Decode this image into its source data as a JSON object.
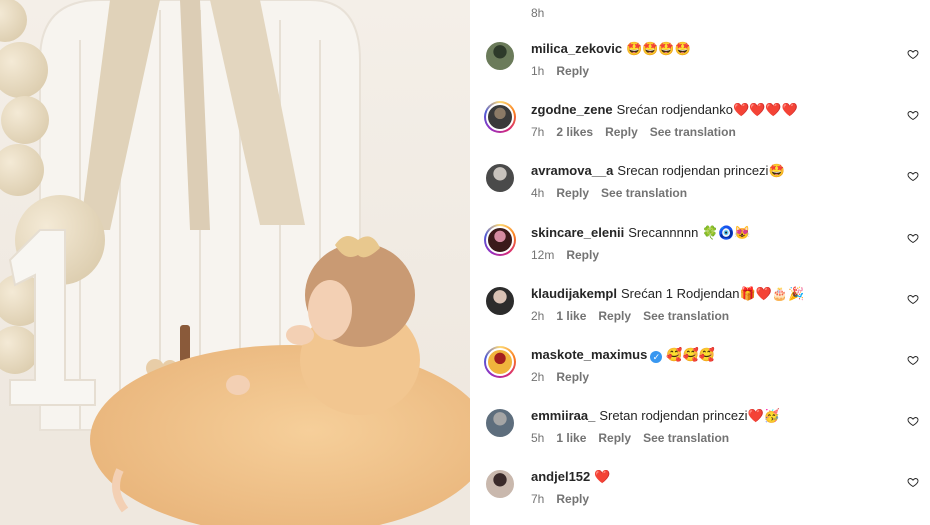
{
  "post": {
    "time_ago": "8h"
  },
  "comments": [
    {
      "username": "milica_zekovic",
      "text": "🤩🤩🤩🤩",
      "time": "1h",
      "likes": "",
      "reply": "Reply",
      "translate": ""
    },
    {
      "username": "zgodne_zene",
      "text": "Srećan rodjendanko❤️❤️❤️❤️",
      "time": "7h",
      "likes": "2 likes",
      "reply": "Reply",
      "translate": "See translation"
    },
    {
      "username": "avramova__a",
      "text": "Srecan rodjendan princezi🤩",
      "time": "4h",
      "likes": "",
      "reply": "Reply",
      "translate": "See translation"
    },
    {
      "username": "skincare_elenii",
      "text": "Srecannnnn 🍀🧿😻",
      "time": "12m",
      "likes": "",
      "reply": "Reply",
      "translate": ""
    },
    {
      "username": "klaudijakempl",
      "text": "Srećan 1 Rodjendan🎁❤️🎂🎉",
      "time": "2h",
      "likes": "1 like",
      "reply": "Reply",
      "translate": "See translation"
    },
    {
      "username": "maskote_maximus",
      "text": "🥰🥰🥰",
      "time": "2h",
      "likes": "",
      "reply": "Reply",
      "translate": "",
      "verified": true
    },
    {
      "username": "emmiiraa_",
      "text": "Sretan rodjendan princezi❤️🥳",
      "time": "5h",
      "likes": "1 like",
      "reply": "Reply",
      "translate": "See translation"
    },
    {
      "username": "andjel152",
      "text": "❤️",
      "time": "7h",
      "likes": "",
      "reply": "Reply",
      "translate": ""
    }
  ],
  "colors": {
    "meta": "#737373",
    "verified": "#3897f0"
  },
  "icons": {
    "like": "heart-outline-icon",
    "verified": "verified-badge-icon"
  }
}
